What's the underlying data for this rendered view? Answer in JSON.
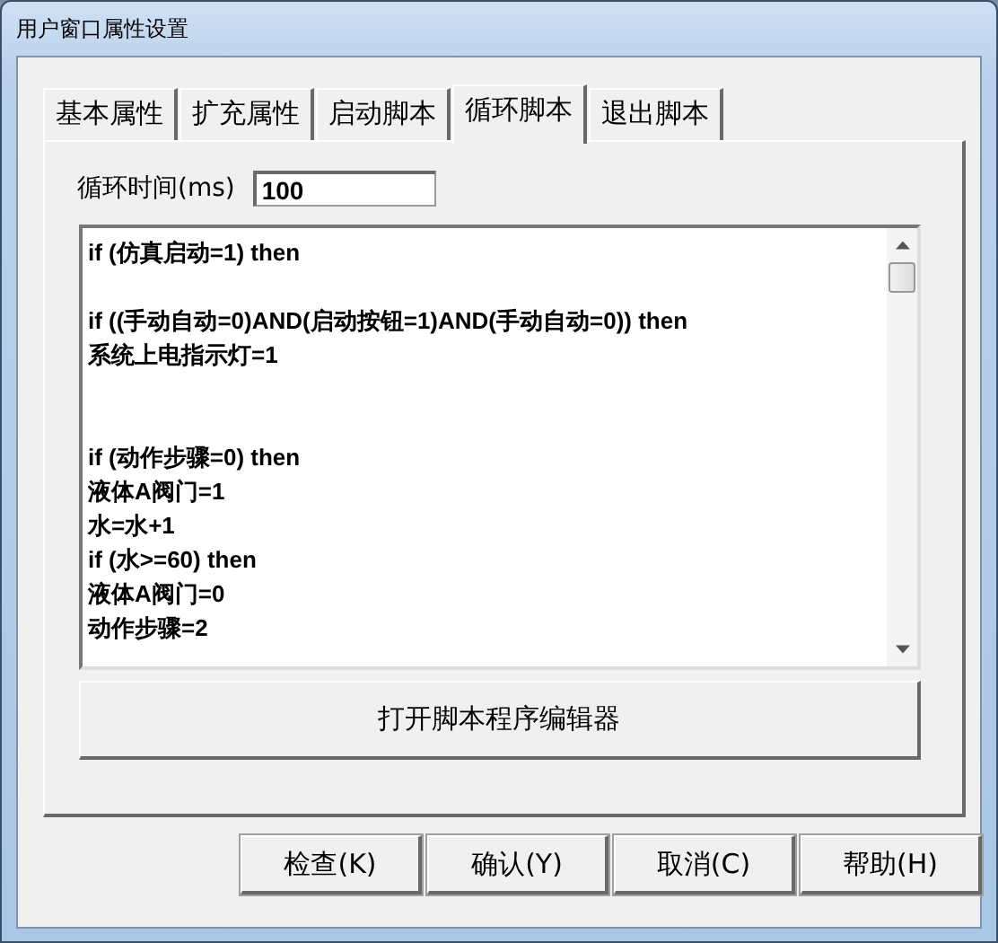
{
  "window": {
    "title": "用户窗口属性设置"
  },
  "tabs": [
    {
      "label": "基本属性",
      "selected": false
    },
    {
      "label": "扩充属性",
      "selected": false
    },
    {
      "label": "启动脚本",
      "selected": false
    },
    {
      "label": "循环脚本",
      "selected": true
    },
    {
      "label": "退出脚本",
      "selected": false
    }
  ],
  "cycle_time": {
    "label": "循环时间(ms)",
    "value": "100"
  },
  "script": "if (仿真启动=1) then\n\nif ((手动自动=0)AND(启动按钮=1)AND(手动自动=0)) then\n系统上电指示灯=1\n\n\nif (动作步骤=0) then\n液体A阀门=1\n水=水+1\nif (水>=60) then\n液体A阀门=0\n动作步骤=2",
  "editor_button": "打开脚本程序编辑器",
  "buttons": [
    "检查(K)",
    "确认(Y)",
    "取消(C)",
    "帮助(H)"
  ]
}
